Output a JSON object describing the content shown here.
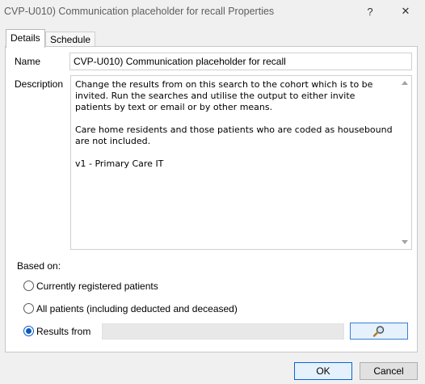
{
  "window": {
    "title": "CVP-U010) Communication placeholder for recall Properties",
    "help_glyph": "?",
    "close_glyph": "✕"
  },
  "tabs": [
    {
      "label": "Details",
      "active": true
    },
    {
      "label": "Schedule",
      "active": false
    }
  ],
  "form": {
    "name_label": "Name",
    "name_value": "CVP-U010) Communication placeholder for recall",
    "description_label": "Description",
    "description_value": "Change the results from on this search to the cohort which is to be\ninvited. Run the searches and utilise the output to either invite\npatients by text or email or by other means.\n\nCare home residents and those patients who are coded as housebound\nare not included.\n\nv1 - Primary Care IT",
    "based_on_label": "Based on:",
    "options": [
      {
        "label": "Currently registered patients",
        "checked": false
      },
      {
        "label": "All patients (including deducted and deceased)",
        "checked": false
      },
      {
        "label": "Results from",
        "checked": true
      }
    ],
    "results_from_value": ""
  },
  "buttons": {
    "ok": "OK",
    "cancel": "Cancel"
  },
  "icons": {
    "search": "magnifier-icon"
  },
  "colors": {
    "accent": "#0a59c2",
    "button_focus_border": "#0a64d6"
  }
}
